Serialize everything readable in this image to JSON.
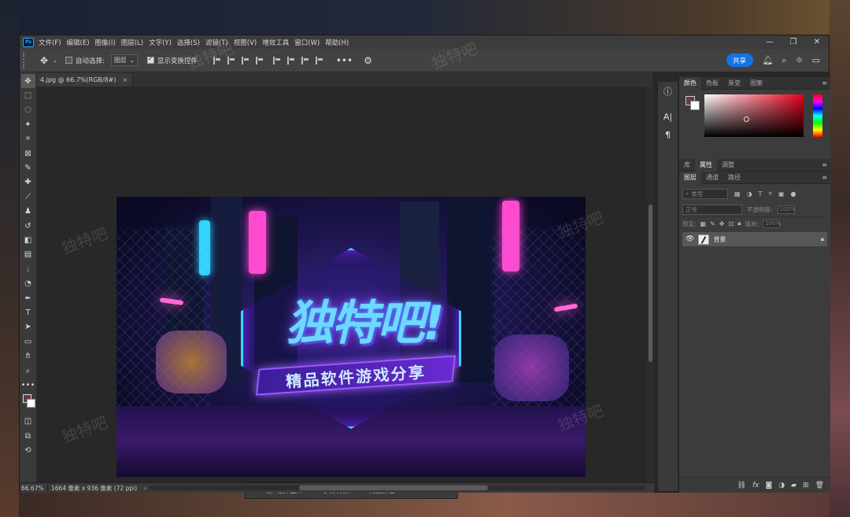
{
  "app": {
    "logo": "Ps",
    "menu": [
      "文件(F)",
      "编辑(E)",
      "图像(I)",
      "图层(L)",
      "文字(Y)",
      "选择(S)",
      "滤镜(T)",
      "视图(V)",
      "增效工具",
      "窗口(W)",
      "帮助(H)"
    ]
  },
  "options": {
    "auto_select_label": "自动选择:",
    "auto_select_value": "图层",
    "show_transform_label": "显示变换控件",
    "share_label": "共享"
  },
  "document": {
    "tab_title": "4.jpg @ 66.7%(RGB/8#)",
    "close": "×"
  },
  "image": {
    "headline": "独特吧!",
    "subtitle": "精品软件游戏分享"
  },
  "context_bar": {
    "select_subject": "选择主体",
    "remove_bg": "移除背景",
    "adjust_color": "调整颜色",
    "more": "•••"
  },
  "status": {
    "zoom": "66.67%",
    "doc_info": "1664 像素 x 936 像素 (72 ppi)"
  },
  "color_panel": {
    "tabs": [
      "颜色",
      "色板",
      "渐变",
      "图案"
    ],
    "fg_color": "#6b3a3d",
    "bg_color": "#ffffff"
  },
  "props_panel": {
    "tabs": [
      "库",
      "属性",
      "调整"
    ]
  },
  "layers_panel": {
    "tabs": [
      "图层",
      "通道",
      "路径"
    ],
    "filter_placeholder": "类型",
    "blend_mode": "正常",
    "opacity_label": "不透明度:",
    "opacity_value": "100%",
    "lock_label": "锁定:",
    "fill_label": "填充:",
    "fill_value": "100%",
    "layers": [
      {
        "name": "背景",
        "visible": true,
        "locked": true
      }
    ]
  },
  "watermark_text": "独特吧"
}
